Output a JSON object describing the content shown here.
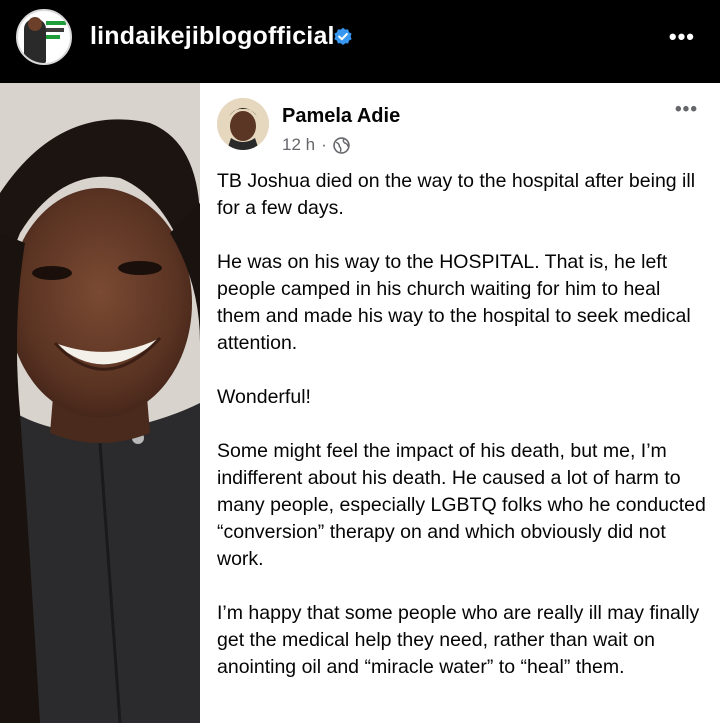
{
  "instagram": {
    "username": "lindaikejiblogofficial",
    "more_label": "•••",
    "verified_color": "#3897f0"
  },
  "post": {
    "author": "Pamela Adie",
    "time": "12 h",
    "separator": "·",
    "privacy_icon": "globe-icon",
    "more_label": "•••",
    "paragraphs": [
      "TB Joshua died on the way to the hospital after being ill for a few days.",
      "He was on his way to the HOSPITAL. That is, he left people camped in his church waiting for him to heal them and made his way to the hospital to seek medical attention.",
      "Wonderful!",
      "Some might feel the impact of his death, but me, I’m indifferent about his death. He caused a lot of harm to many people, especially LGBTQ folks who he conducted “conversion” therapy on and which obviously did not work.",
      "I’m happy that some people who are really ill may finally get the medical help they need, rather than wait on anointing oil and “miracle water” to “heal” them."
    ]
  }
}
